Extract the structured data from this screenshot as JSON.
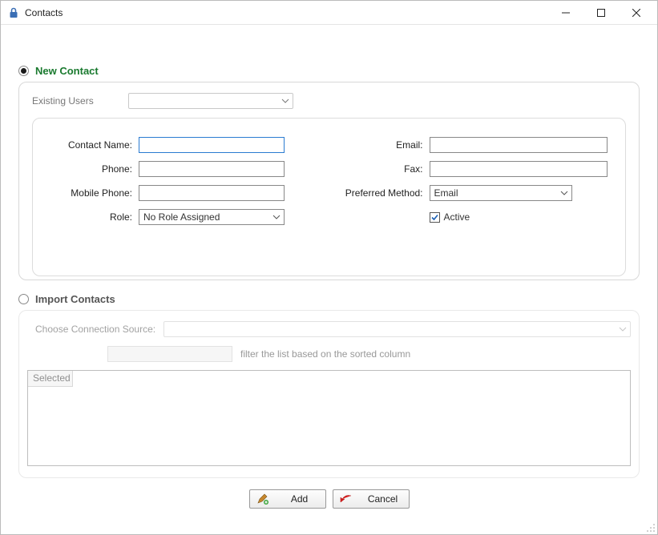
{
  "window": {
    "title": "Contacts"
  },
  "sections": {
    "new_contact_label": "New Contact",
    "import_label": "Import Contacts"
  },
  "existing_users_label": "Existing Users",
  "fields": {
    "contact_name": {
      "label": "Contact Name:",
      "value": ""
    },
    "phone": {
      "label": "Phone:",
      "value": ""
    },
    "mobile_phone": {
      "label": "Mobile Phone:",
      "value": ""
    },
    "role": {
      "label": "Role:",
      "value": "No Role Assigned"
    },
    "email": {
      "label": "Email:",
      "value": ""
    },
    "fax": {
      "label": "Fax:",
      "value": ""
    },
    "preferred_method": {
      "label": "Preferred Method:",
      "value": "Email"
    },
    "active_label": "Active",
    "active_checked": true
  },
  "import": {
    "source_label": "Choose Connection Source:",
    "filter_hint": "filter the list based on the sorted column",
    "grid_col_selected": "Selected"
  },
  "buttons": {
    "add": "Add",
    "cancel": "Cancel"
  },
  "radio": {
    "new_contact_selected": true,
    "import_selected": false
  }
}
